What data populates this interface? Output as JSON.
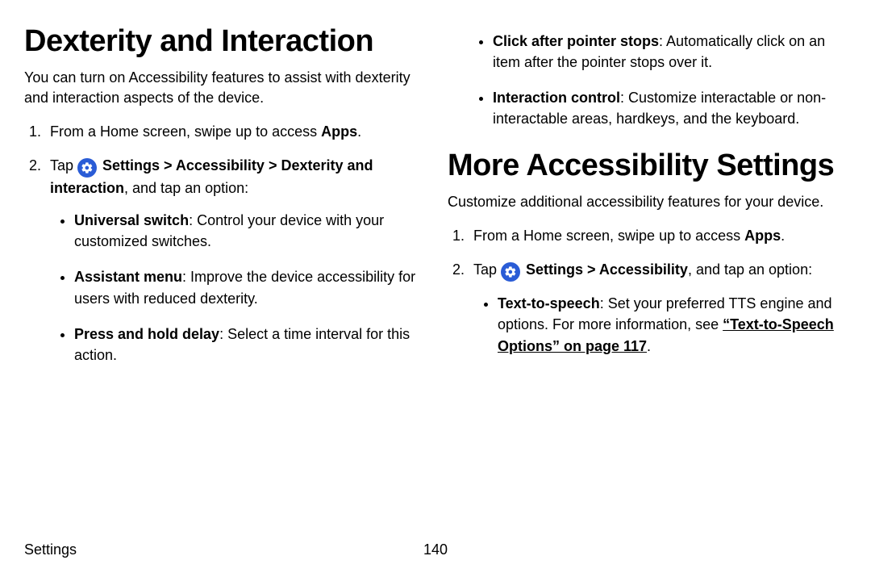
{
  "left": {
    "heading": "Dexterity and Interaction",
    "intro": "You can turn on Accessibility features to assist with dexterity and interaction aspects of the device.",
    "step1_pre": "From a Home screen, swipe up to access ",
    "step1_bold": "Apps",
    "step1_post": ".",
    "step2_pre": "Tap ",
    "step2_path": " Settings > Accessibility > Dexterity and interaction",
    "step2_post": ", and tap an option:",
    "bullets": [
      {
        "bold": "Universal switch",
        "rest": ": Control your device with your customized switches."
      },
      {
        "bold": "Assistant menu",
        "rest": ": Improve the device accessibility for users with reduced dexterity."
      },
      {
        "bold": "Press and hold delay",
        "rest": ": Select a time interval for this action."
      }
    ]
  },
  "rightTop": {
    "bullets": [
      {
        "bold": "Click after pointer stops",
        "rest": ": Automatically click on an item after the pointer stops over it."
      },
      {
        "bold": "Interaction control",
        "rest": ": Customize interactable or non-interactable areas, hardkeys, and the keyboard."
      }
    ]
  },
  "right": {
    "heading": "More Accessibility Settings",
    "intro": "Customize additional accessibility features for your device.",
    "step1_pre": "From a Home screen, swipe up to access ",
    "step1_bold": "Apps",
    "step1_post": ".",
    "step2_pre": "Tap ",
    "step2_path": " Settings > Accessibility",
    "step2_post": ", and tap an option:",
    "bullets": [
      {
        "bold": "Text-to-speech",
        "rest": ": Set your preferred TTS engine and options. For more information, see ",
        "link": "“Text-to-Speech Options” on page 117",
        "after": "."
      }
    ]
  },
  "footer": {
    "section": "Settings",
    "page": "140"
  }
}
